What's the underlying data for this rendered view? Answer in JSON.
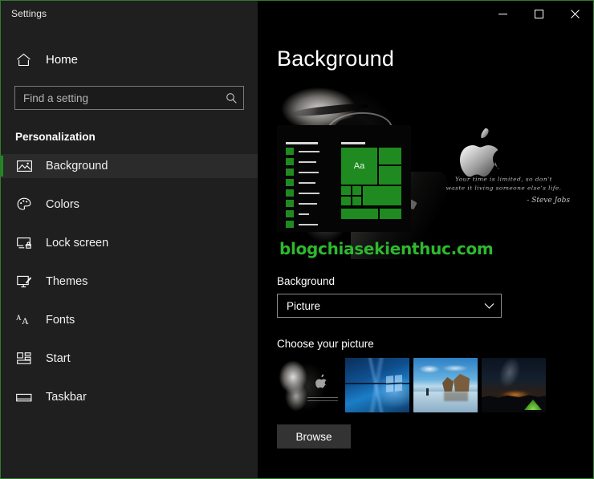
{
  "window": {
    "title": "Settings",
    "controls": [
      {
        "name": "minimize",
        "glyph": "minimize-icon"
      },
      {
        "name": "maximize",
        "glyph": "maximize-icon"
      },
      {
        "name": "close",
        "glyph": "close-icon"
      }
    ],
    "accent_color": "#1f8a1f",
    "border_color": "#2f7a2f",
    "sidebar_bg": "#1f1f1f",
    "main_bg": "#000000"
  },
  "sidebar": {
    "home_label": "Home",
    "home_icon": "home-icon",
    "search": {
      "placeholder": "Find a setting",
      "value": "",
      "icon": "search-icon"
    },
    "group_title": "Personalization",
    "items": [
      {
        "label": "Background",
        "icon": "picture-icon",
        "selected": true
      },
      {
        "label": "Colors",
        "icon": "palette-icon",
        "selected": false
      },
      {
        "label": "Lock screen",
        "icon": "lock-screen-icon",
        "selected": false
      },
      {
        "label": "Themes",
        "icon": "brush-icon",
        "selected": false
      },
      {
        "label": "Fonts",
        "icon": "fonts-icon",
        "selected": false
      },
      {
        "label": "Start",
        "icon": "start-tiles-icon",
        "selected": false
      },
      {
        "label": "Taskbar",
        "icon": "taskbar-icon",
        "selected": false
      }
    ]
  },
  "main": {
    "page_title": "Background",
    "preview": {
      "tile_letter": "Aa",
      "quote_line1": "Your time is limited, so don't",
      "quote_line2": "waste it living someone else's life.",
      "quote_author": "- Steve Jobs",
      "watermark": "blogchiasekienthuc.com",
      "watermark_color": "#2fb82f",
      "apple_icon": "apple-logo-icon"
    },
    "background_field": {
      "label": "Background",
      "value": "Picture",
      "chevron": "chevron-down-icon"
    },
    "choose_picture": {
      "label": "Choose your picture",
      "thumbnails": [
        {
          "name": "steve-jobs-wallpaper",
          "selected": false
        },
        {
          "name": "windows-hero-wallpaper",
          "selected": false
        },
        {
          "name": "beach-rocks-wallpaper",
          "selected": false
        },
        {
          "name": "night-sky-tent-wallpaper",
          "selected": false
        }
      ],
      "browse_label": "Browse"
    }
  }
}
